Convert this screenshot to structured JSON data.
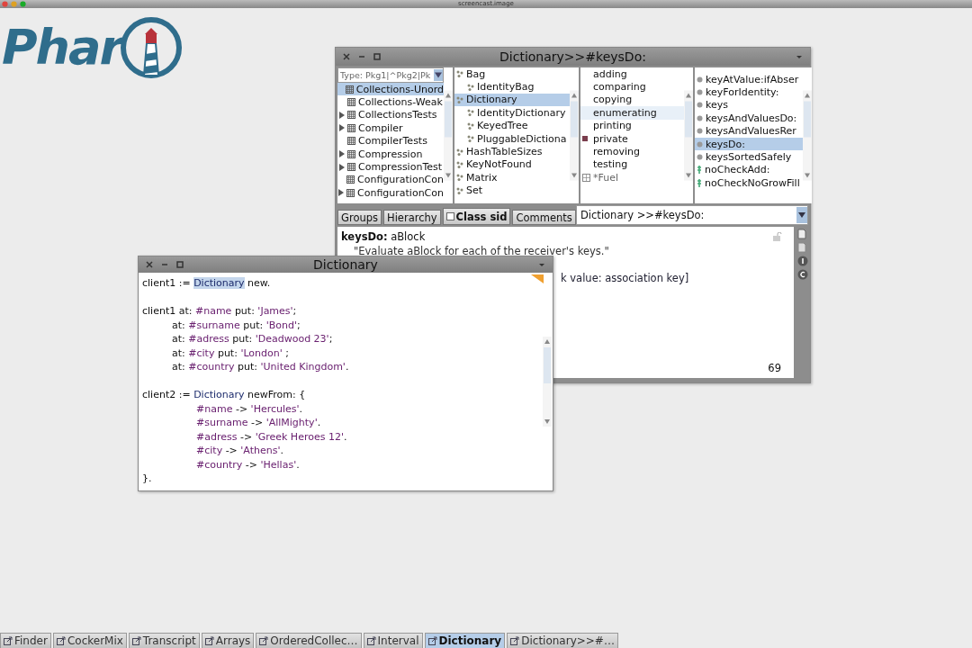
{
  "screen_title": "screencast.image",
  "logo": {
    "text": "Phar"
  },
  "browser": {
    "title": "Dictionary>>#keysDo:",
    "package_filter": {
      "placeholder": "Type: Pkg1|^Pkg2|Pk"
    },
    "packages": [
      {
        "label": "Collections-Unord",
        "selected": true,
        "expandable": false
      },
      {
        "label": "Collections-Weak",
        "selected": false,
        "expandable": false
      },
      {
        "label": "CollectionsTests",
        "selected": false,
        "expandable": true
      },
      {
        "label": "Compiler",
        "selected": false,
        "expandable": true
      },
      {
        "label": "CompilerTests",
        "selected": false,
        "expandable": false
      },
      {
        "label": "Compression",
        "selected": false,
        "expandable": true
      },
      {
        "label": "CompressionTest",
        "selected": false,
        "expandable": true
      },
      {
        "label": "ConfigurationCon",
        "selected": false,
        "expandable": false
      },
      {
        "label": "ConfigurationCon",
        "selected": false,
        "expandable": true
      }
    ],
    "classes": [
      {
        "label": "Bag",
        "selected": false,
        "children": [
          {
            "label": "IdentityBag",
            "selected": false
          }
        ]
      },
      {
        "label": "Dictionary",
        "selected": true,
        "children": [
          {
            "label": "IdentityDictionary",
            "selected": false
          },
          {
            "label": "KeyedTree",
            "selected": false
          },
          {
            "label": "PluggableDictiona",
            "selected": false
          }
        ]
      },
      {
        "label": "HashTableSizes",
        "selected": false
      },
      {
        "label": "KeyNotFound",
        "selected": false
      },
      {
        "label": "Matrix",
        "selected": false
      },
      {
        "label": "Set",
        "selected": false
      }
    ],
    "protocols": [
      {
        "label": "adding",
        "selected": false,
        "kind": "plain"
      },
      {
        "label": "comparing",
        "selected": false,
        "kind": "plain"
      },
      {
        "label": "copying",
        "selected": false,
        "kind": "plain"
      },
      {
        "label": "enumerating",
        "selected": true,
        "kind": "plain"
      },
      {
        "label": "printing",
        "selected": false,
        "kind": "plain"
      },
      {
        "label": "private",
        "selected": false,
        "kind": "private"
      },
      {
        "label": "removing",
        "selected": false,
        "kind": "plain"
      },
      {
        "label": "testing",
        "selected": false,
        "kind": "plain"
      },
      {
        "label": "*Fuel",
        "selected": false,
        "kind": "extension"
      }
    ],
    "methods": [
      {
        "label": "keyAtValue:ifAbser",
        "selected": false,
        "kind": "normal"
      },
      {
        "label": "keyForIdentity:",
        "selected": false,
        "kind": "normal"
      },
      {
        "label": "keys",
        "selected": false,
        "kind": "normal"
      },
      {
        "label": "keysAndValuesDo:",
        "selected": false,
        "kind": "normal"
      },
      {
        "label": "keysAndValuesRer",
        "selected": false,
        "kind": "normal"
      },
      {
        "label": "keysDo:",
        "selected": true,
        "kind": "normal"
      },
      {
        "label": "keysSortedSafely",
        "selected": false,
        "kind": "normal"
      },
      {
        "label": "noCheckAdd:",
        "selected": false,
        "kind": "private"
      },
      {
        "label": "noCheckNoGrowFill",
        "selected": false,
        "kind": "private"
      }
    ],
    "buttons": [
      {
        "label": "Groups",
        "kind": "button"
      },
      {
        "label": "Hierarchy",
        "kind": "button"
      },
      {
        "label": "Class sid",
        "kind": "checkbox",
        "checked": false
      },
      {
        "label": "Comments",
        "kind": "button"
      }
    ],
    "method_field": {
      "value": "Dictionary >>#keysDo:"
    },
    "source": [
      {
        "bold": "keysDo:",
        "text": " aBlock"
      },
      {
        "text": "\"Evaluate aBlock for each of the receiver's keys.\"",
        "kind": "comment"
      }
    ],
    "source_fragment": "k value: association key]",
    "line_count": "69"
  },
  "workspace": {
    "title": "Dictionary",
    "lines": [
      {
        "kind": "statement",
        "space_before": false,
        "segments": [
          {
            "text": "client1 := ",
            "kind": "plain"
          },
          {
            "text": "Dictionary",
            "kind": "class-selected"
          },
          {
            "text": " new.",
            "kind": "plain"
          }
        ]
      },
      {
        "kind": "statement",
        "space_before": true,
        "segments": [
          {
            "text": "client1 at: ",
            "kind": "plain"
          },
          {
            "text": "#name",
            "kind": "symbol"
          },
          {
            "text": " put: ",
            "kind": "plain"
          },
          {
            "text": "'James'",
            "kind": "string"
          },
          {
            "text": ";",
            "kind": "plain"
          }
        ]
      },
      {
        "kind": "cascade",
        "space_before": false,
        "segments": [
          {
            "text": "at: ",
            "kind": "plain"
          },
          {
            "text": "#surname",
            "kind": "symbol"
          },
          {
            "text": " put: ",
            "kind": "plain"
          },
          {
            "text": "'Bond'",
            "kind": "string"
          },
          {
            "text": ";",
            "kind": "plain"
          }
        ]
      },
      {
        "kind": "cascade",
        "space_before": false,
        "segments": [
          {
            "text": "at: ",
            "kind": "plain"
          },
          {
            "text": "#adress",
            "kind": "symbol"
          },
          {
            "text": " put: ",
            "kind": "plain"
          },
          {
            "text": "'Deadwood 23'",
            "kind": "string"
          },
          {
            "text": ";",
            "kind": "plain"
          }
        ]
      },
      {
        "kind": "cascade",
        "space_before": false,
        "segments": [
          {
            "text": "at: ",
            "kind": "plain"
          },
          {
            "text": "#city",
            "kind": "symbol"
          },
          {
            "text": " put: ",
            "kind": "plain"
          },
          {
            "text": "'London'",
            "kind": "string"
          },
          {
            "text": " ;",
            "kind": "plain"
          }
        ]
      },
      {
        "kind": "cascade",
        "space_before": false,
        "segments": [
          {
            "text": "at: ",
            "kind": "plain"
          },
          {
            "text": "#country",
            "kind": "symbol"
          },
          {
            "text": " put: ",
            "kind": "plain"
          },
          {
            "text": "'United Kingdom'",
            "kind": "string"
          },
          {
            "text": ".",
            "kind": "plain"
          }
        ]
      },
      {
        "kind": "statement",
        "space_before": true,
        "segments": [
          {
            "text": "client2 := ",
            "kind": "plain"
          },
          {
            "text": "Dictionary",
            "kind": "class"
          },
          {
            "text": " newFrom: {",
            "kind": "plain"
          }
        ]
      },
      {
        "kind": "element",
        "space_before": false,
        "segments": [
          {
            "text": "#name",
            "kind": "symbol"
          },
          {
            "text": " -> ",
            "kind": "plain"
          },
          {
            "text": "'Hercules'",
            "kind": "string"
          },
          {
            "text": ".",
            "kind": "plain"
          }
        ]
      },
      {
        "kind": "element",
        "space_before": false,
        "segments": [
          {
            "text": "#surname",
            "kind": "symbol"
          },
          {
            "text": " -> ",
            "kind": "plain"
          },
          {
            "text": "'AllMighty'",
            "kind": "string"
          },
          {
            "text": ".",
            "kind": "plain"
          }
        ]
      },
      {
        "kind": "element",
        "space_before": false,
        "segments": [
          {
            "text": "#adress",
            "kind": "symbol"
          },
          {
            "text": " -> ",
            "kind": "plain"
          },
          {
            "text": "'Greek Heroes 12'",
            "kind": "string"
          },
          {
            "text": ".",
            "kind": "plain"
          }
        ]
      },
      {
        "kind": "element",
        "space_before": false,
        "segments": [
          {
            "text": "#city",
            "kind": "symbol"
          },
          {
            "text": " -> ",
            "kind": "plain"
          },
          {
            "text": "'Athens'",
            "kind": "string"
          },
          {
            "text": ".",
            "kind": "plain"
          }
        ]
      },
      {
        "kind": "element",
        "space_before": false,
        "segments": [
          {
            "text": "#country",
            "kind": "symbol"
          },
          {
            "text": " -> ",
            "kind": "plain"
          },
          {
            "text": "'Hellas'",
            "kind": "string"
          },
          {
            "text": ".",
            "kind": "plain"
          }
        ]
      },
      {
        "kind": "statement",
        "space_before": false,
        "segments": [
          {
            "text": "}.",
            "kind": "plain"
          }
        ]
      }
    ]
  },
  "taskbar": [
    {
      "label": "Finder",
      "selected": false
    },
    {
      "label": "CockerMix",
      "selected": false
    },
    {
      "label": "Transcript",
      "selected": false
    },
    {
      "label": "Arrays",
      "selected": false
    },
    {
      "label": "OrderedCollec…",
      "selected": false
    },
    {
      "label": "Interval",
      "selected": false
    },
    {
      "label": "Dictionary",
      "selected": true
    },
    {
      "label": "Dictionary>>#…",
      "selected": false
    }
  ]
}
